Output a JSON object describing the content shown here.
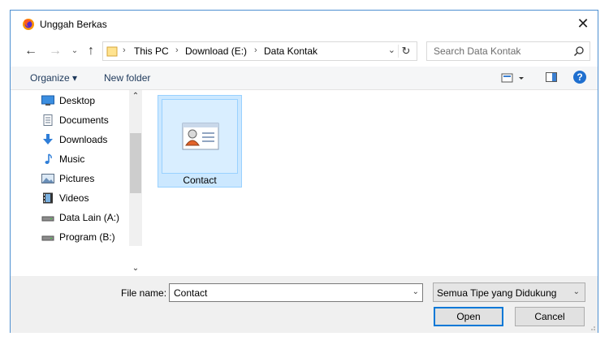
{
  "window": {
    "title": "Unggah Berkas",
    "close_symbol": "✕"
  },
  "nav_buttons": {
    "back": "←",
    "forward": "→",
    "recent": "⌄",
    "up": "↑"
  },
  "address": {
    "crumbs": [
      "This PC",
      "Download (E:)",
      "Data Kontak"
    ],
    "separator": "›",
    "dropdown": "⌄",
    "refresh": "↻"
  },
  "search": {
    "placeholder": "Search Data Kontak"
  },
  "toolbar": {
    "organize_label": "Organize ▾",
    "new_folder_label": "New folder",
    "help_label": "?"
  },
  "sidebar": {
    "items": [
      {
        "label": "Desktop",
        "icon": "desktop-icon"
      },
      {
        "label": "Documents",
        "icon": "documents-icon"
      },
      {
        "label": "Downloads",
        "icon": "downloads-icon"
      },
      {
        "label": "Music",
        "icon": "music-icon"
      },
      {
        "label": "Pictures",
        "icon": "pictures-icon"
      },
      {
        "label": "Videos",
        "icon": "videos-icon"
      },
      {
        "label": "Data Lain (A:)",
        "icon": "drive-icon"
      },
      {
        "label": "Program (B:)",
        "icon": "drive-icon"
      }
    ],
    "scroll_up": "⌃",
    "scroll_down": "⌄"
  },
  "files": [
    {
      "name": "Contact",
      "icon": "contact-file-icon",
      "selected": true
    }
  ],
  "bottom": {
    "file_name_label": "File name:",
    "file_name_value": "Contact",
    "file_type_value": "Semua Tipe yang Didukung",
    "dropdown_arrow": "⌄",
    "open_label": "Open",
    "cancel_label": "Cancel"
  },
  "colors": {
    "accent": "#0078d7",
    "selection_bg": "#cce8ff",
    "selection_border": "#99d1ff",
    "link_text": "#1e395b",
    "help_blue": "#1f6fcf"
  }
}
